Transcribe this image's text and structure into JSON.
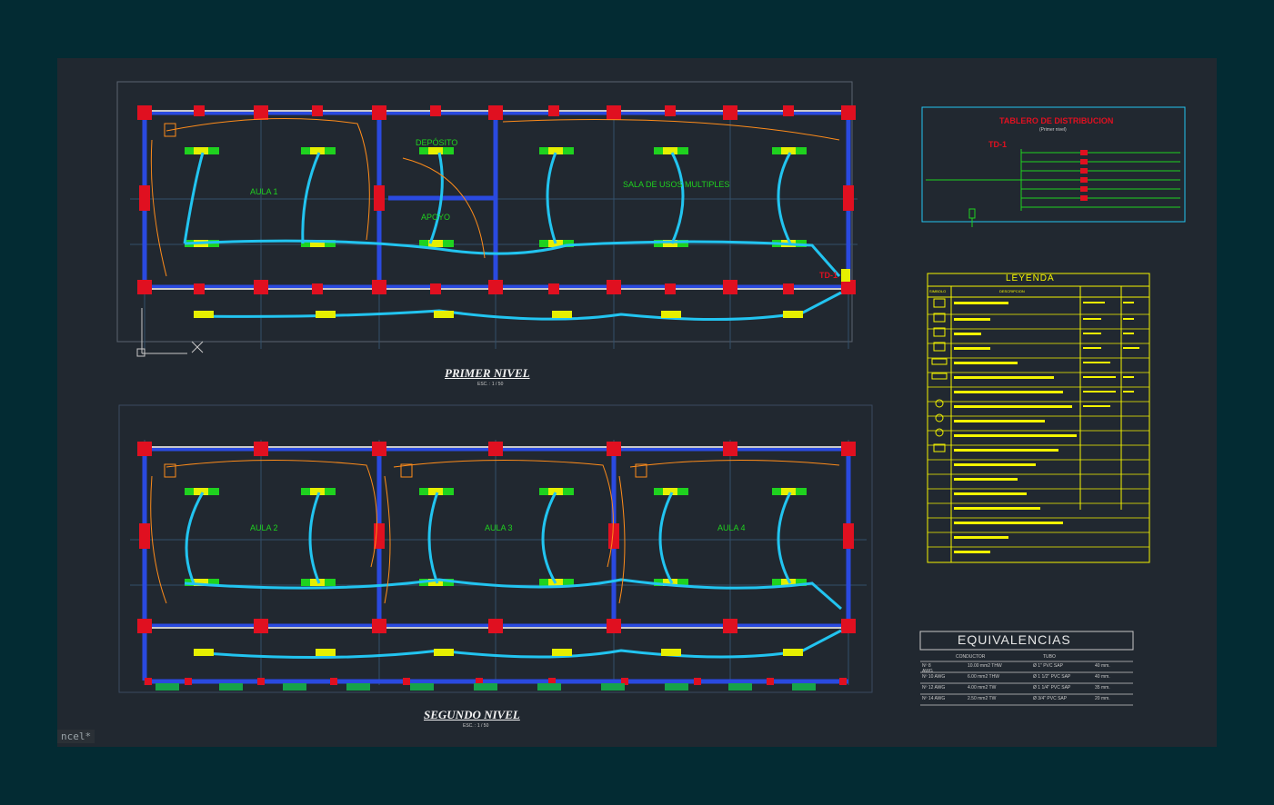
{
  "command_line": {
    "text": "ncel*"
  },
  "floor1": {
    "title": "PRIMER NIVEL",
    "scale": "ESC. : 1 / 50",
    "rooms": [
      "AULA 1",
      "DEPÓSITO",
      "APOYO",
      "SALA DE USOS MULTIPLES"
    ],
    "panel_tag": "TD-1"
  },
  "floor2": {
    "title": "SEGUNDO NIVEL",
    "scale": "ESC. : 1 / 50",
    "rooms": [
      "AULA 2",
      "AULA 3",
      "AULA 4"
    ]
  },
  "tablero": {
    "title": "TABLERO DE DISTRIBUCION",
    "subtitle": "(Primer nivel)",
    "tag": "TD-1"
  },
  "leyenda": {
    "title": "LEYENDA",
    "headers": [
      "SIMBOLO",
      "DESCRIPCION"
    ]
  },
  "equivalencias": {
    "title": "EQUIVALENCIAS",
    "headers": [
      "CONDUCTOR",
      "TUBO"
    ],
    "rows": [
      [
        "Nº 8 AWG",
        "10.00 mm2 THW",
        "Ø 1\" PVC SAP",
        "40 mm."
      ],
      [
        "Nº 10 AWG",
        "6.00 mm2 THW",
        "Ø 1 1/2\" PVC SAP",
        "40 mm."
      ],
      [
        "Nº 12 AWG",
        "4.00 mm2 TW",
        "Ø 1 1/4\" PVC SAP",
        "35 mm."
      ],
      [
        "Nº 14 AWG",
        "2.50 mm2 TW",
        "Ø 3/4\" PVC SAP",
        "20 mm."
      ]
    ]
  },
  "colors": {
    "background": "#032b33",
    "canvas": "#212830",
    "wall": "#2a4ae0",
    "column": "#e01020",
    "circuit": "#22c4f0",
    "room_label": "#1fd21f",
    "legend": "#f5f500"
  }
}
